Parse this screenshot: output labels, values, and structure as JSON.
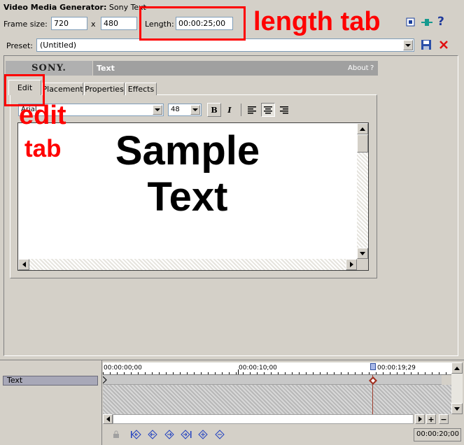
{
  "window": {
    "title_label": "Video Media Generator:",
    "title_value": "Sony Text"
  },
  "frame": {
    "label": "Frame size:",
    "width": "720",
    "sep": "x",
    "height": "480",
    "length_label": "Length:",
    "length_value": "00:00:25;00"
  },
  "preset": {
    "label": "Preset:",
    "value": "(Untitled)"
  },
  "plugin": {
    "brand": "SONY.",
    "name": "Text",
    "about": "About",
    "help": "?"
  },
  "tabs": [
    {
      "label": "Edit"
    },
    {
      "label": "Placement"
    },
    {
      "label": "Properties"
    },
    {
      "label": "Effects"
    }
  ],
  "editor": {
    "font_name": "Arial",
    "font_size": "48",
    "bold": "B",
    "italic": "I",
    "text_line1": "Sample",
    "text_line2": "Text"
  },
  "annotations": {
    "length_tab": "length tab",
    "edit_line1": "edit",
    "edit_line2": "tab"
  },
  "timeline": {
    "track_label": "Text",
    "time_start": "00:00:00;00",
    "time_mid": "00:00:10;00",
    "time_cursor": "00:00:19;29",
    "current_time": "00:00:20;00"
  },
  "colors": {
    "annotation_red": "#ff0000",
    "plugin_header": "#a0a0a0",
    "keyframe": "#a03020"
  }
}
